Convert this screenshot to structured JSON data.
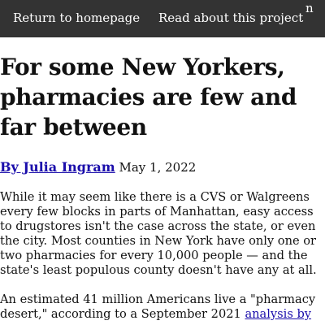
{
  "nav": {
    "home_label": "Return to homepage",
    "about_label": "Read about this project",
    "extra_label": "n"
  },
  "article": {
    "title": "For some New Yorkers, pharmacies are few and far between",
    "author": "By Julia Ingram",
    "date": "May 1, 2022",
    "paragraph1": "While it may seem like there is a CVS or Walgreens every few blocks in parts of Manhattan, easy access to drugstores isn't the case across the state, or even the city. Most counties in New York have only one or two pharmacies for every 10,000 people — and the state's least populous county doesn't have any at all.",
    "paragraph2_before_link": "An estimated 41 million Americans live a \"pharmacy desert,\" according to a September 2021 ",
    "paragraph2_link": "analysis by"
  },
  "colors": {
    "nav_background": "#333333",
    "link": "#1a0dab"
  }
}
